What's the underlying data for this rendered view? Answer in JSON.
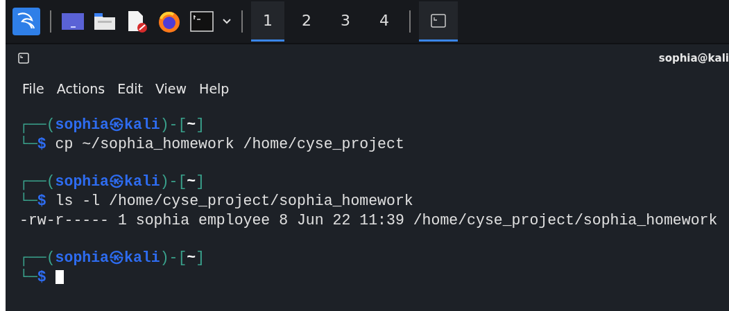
{
  "taskbar": {
    "apps": [
      {
        "kind": "kali"
      },
      {
        "kind": "desktop"
      },
      {
        "kind": "files"
      },
      {
        "kind": "editor"
      },
      {
        "kind": "browser"
      },
      {
        "kind": "terminal"
      },
      {
        "kind": "dropdown"
      }
    ],
    "workspaces": [
      {
        "label": "1",
        "selected": true
      },
      {
        "label": "2",
        "selected": false
      },
      {
        "label": "3",
        "selected": false
      },
      {
        "label": "4",
        "selected": false
      }
    ],
    "windows": [
      {
        "kind": "terminal",
        "selected": true
      }
    ]
  },
  "window": {
    "title": "sophia@kali"
  },
  "menu": [
    "File",
    "Actions",
    "Edit",
    "View",
    "Help"
  ],
  "terminal": {
    "blocks": [
      {
        "prompt": [
          {
            "kind": "frame",
            "text": "┌──("
          },
          {
            "kind": "user",
            "text": "sophia㉿kali"
          },
          {
            "kind": "frame",
            "text": ")-["
          },
          {
            "kind": "dir",
            "text": "~"
          },
          {
            "kind": "frame",
            "text": "]"
          }
        ],
        "input": [
          {
            "kind": "frame",
            "text": "└─"
          },
          {
            "kind": "user",
            "text": "$"
          },
          {
            "kind": "plain",
            "text": " cp ~/sophia_homework /home/cyse_project"
          }
        ],
        "cursor": false
      },
      {
        "prompt": [
          {
            "kind": "frame",
            "text": "┌──("
          },
          {
            "kind": "user",
            "text": "sophia㉿kali"
          },
          {
            "kind": "frame",
            "text": ")-["
          },
          {
            "kind": "dir",
            "text": "~"
          },
          {
            "kind": "frame",
            "text": "]"
          }
        ],
        "input": [
          {
            "kind": "frame",
            "text": "└─"
          },
          {
            "kind": "user",
            "text": "$"
          },
          {
            "kind": "plain",
            "text": " ls -l /home/cyse_project/sophia_homework"
          }
        ],
        "output": [
          "-rw-r----- 1 sophia employee 8 Jun 22 11:39 /home/cyse_project/sophia_homework"
        ],
        "cursor": false
      },
      {
        "prompt": [
          {
            "kind": "frame",
            "text": "┌──("
          },
          {
            "kind": "user",
            "text": "sophia㉿kali"
          },
          {
            "kind": "frame",
            "text": ")-["
          },
          {
            "kind": "dir",
            "text": "~"
          },
          {
            "kind": "frame",
            "text": "]"
          }
        ],
        "input": [
          {
            "kind": "frame",
            "text": "└─"
          },
          {
            "kind": "user",
            "text": "$"
          }
        ],
        "cursor": true
      }
    ]
  }
}
